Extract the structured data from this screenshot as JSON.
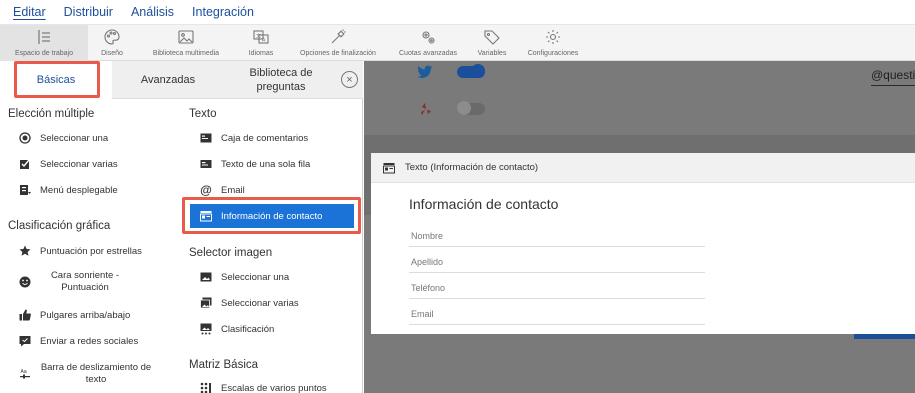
{
  "top_menu": [
    {
      "label": "Editar",
      "active": true
    },
    {
      "label": "Distribuir",
      "active": false
    },
    {
      "label": "Análisis",
      "active": false
    },
    {
      "label": "Integración",
      "active": false
    }
  ],
  "toolbar": [
    {
      "label": "Espacio de trabajo",
      "icon": "workspace-icon",
      "active": true
    },
    {
      "label": "Diseño",
      "icon": "palette-icon"
    },
    {
      "label": "Biblioteca multimedia",
      "icon": "image-icon"
    },
    {
      "label": "Idiomas",
      "icon": "language-icon"
    },
    {
      "label": "Opciones de finalización",
      "icon": "magic-wand-icon"
    },
    {
      "label": "Cuotas avanzadas",
      "icon": "cogs-icon"
    },
    {
      "label": "Variables",
      "icon": "tag-icon"
    },
    {
      "label": "Configuraciones",
      "icon": "gear-icon"
    }
  ],
  "tabs": {
    "basicas": "Básicas",
    "avanzadas": "Avanzadas",
    "biblioteca": "Biblioteca de preguntas",
    "close": "×"
  },
  "left_col": {
    "eleccion_title": "Elección múltiple",
    "eleccion_items": [
      "Seleccionar una",
      "Seleccionar varias",
      "Menú desplegable"
    ],
    "clasificacion_title": "Clasificación gráfica",
    "clasificacion_items": [
      "Puntuación por estrellas",
      "Cara sonriente - Puntuación",
      "Pulgares arriba/abajo",
      "Enviar a redes sociales",
      "Barra de deslizamiento de texto"
    ]
  },
  "right_col": {
    "texto_title": "Texto",
    "texto_items": [
      "Caja de comentarios",
      "Texto de una sola fila",
      "Email",
      "Información de contacto"
    ],
    "selector_title": "Selector imagen",
    "selector_items": [
      "Seleccionar una",
      "Seleccionar varias",
      "Clasificación"
    ],
    "matriz_title": "Matriz Básica",
    "matriz_items": [
      "Escalas de varios puntos"
    ]
  },
  "background": {
    "social_handle": "@questionpro"
  },
  "dialog": {
    "header": "Texto (Información de contacto)",
    "title": "Información de contacto",
    "fields": [
      "Nombre",
      "Apellido",
      "Teléfono",
      "Email"
    ]
  },
  "colors": {
    "accent": "#1b4f9c",
    "selected": "#1b73d8",
    "highlight": "#e85b4a",
    "overlay": "#7a7a7a",
    "twitter": "#1da1f2",
    "yelp": "#d32323"
  }
}
